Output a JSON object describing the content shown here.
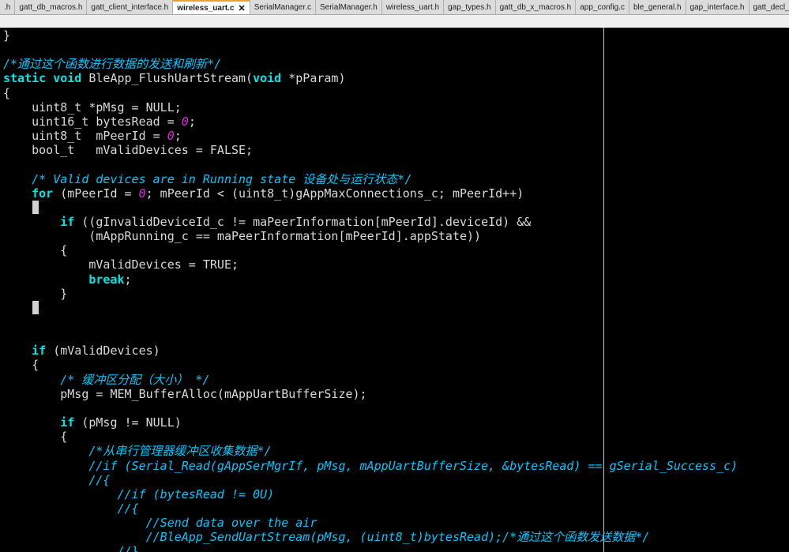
{
  "tabs": [
    {
      "label": ".h",
      "active": false
    },
    {
      "label": "gatt_db_macros.h",
      "active": false
    },
    {
      "label": "gatt_client_interface.h",
      "active": false
    },
    {
      "label": "wireless_uart.c",
      "active": true,
      "close": "✕"
    },
    {
      "label": "SerialManager.c",
      "active": false
    },
    {
      "label": "SerialManager.h",
      "active": false
    },
    {
      "label": "wireless_uart.h",
      "active": false
    },
    {
      "label": "gap_types.h",
      "active": false
    },
    {
      "label": "gatt_db_x_macros.h",
      "active": false
    },
    {
      "label": "app_config.c",
      "active": false
    },
    {
      "label": "ble_general.h",
      "active": false
    },
    {
      "label": "gap_interface.h",
      "active": false
    },
    {
      "label": "gatt_decl_x.h",
      "active": false
    }
  ],
  "code": [
    [
      [
        "p",
        "}"
      ]
    ],
    [],
    [
      [
        "c",
        "/*通过这个函数进行数据的发送和刷新*/"
      ]
    ],
    [
      [
        "k",
        "static"
      ],
      [
        "p",
        " "
      ],
      [
        "k",
        "void"
      ],
      [
        "p",
        " BleApp_FlushUartStream("
      ],
      [
        "k",
        "void"
      ],
      [
        "p",
        " *pParam)"
      ]
    ],
    [
      [
        "p",
        "{"
      ]
    ],
    [
      [
        "p",
        "    uint8_t *pMsg = NULL;"
      ]
    ],
    [
      [
        "p",
        "    uint16_t bytesRead = "
      ],
      [
        "n",
        "0"
      ],
      [
        "p",
        ";"
      ]
    ],
    [
      [
        "p",
        "    uint8_t  mPeerId = "
      ],
      [
        "n",
        "0"
      ],
      [
        "p",
        ";"
      ]
    ],
    [
      [
        "p",
        "    bool_t   mValidDevices = FALSE;"
      ]
    ],
    [],
    [
      [
        "p",
        "    "
      ],
      [
        "c",
        "/* Valid devices are in Running state 设备处与运行状态*/"
      ]
    ],
    [
      [
        "p",
        "    "
      ],
      [
        "k",
        "for"
      ],
      [
        "p",
        " (mPeerId = "
      ],
      [
        "n",
        "0"
      ],
      [
        "p",
        "; mPeerId < (uint8_t)gAppMaxConnections_c; mPeerId++)"
      ]
    ],
    [],
    [
      [
        "p",
        "        "
      ],
      [
        "k",
        "if"
      ],
      [
        "p",
        " ((gInvalidDeviceId_c != maPeerInformation[mPeerId].deviceId) &&"
      ]
    ],
    [
      [
        "p",
        "            (mAppRunning_c == maPeerInformation[mPeerId].appState))"
      ]
    ],
    [
      [
        "p",
        "        {"
      ]
    ],
    [
      [
        "p",
        "            mValidDevices = TRUE;"
      ]
    ],
    [
      [
        "p",
        "            "
      ],
      [
        "k",
        "break"
      ],
      [
        "p",
        ";"
      ]
    ],
    [
      [
        "p",
        "        }"
      ]
    ],
    [],
    [],
    [],
    [
      [
        "p",
        "    "
      ],
      [
        "k",
        "if"
      ],
      [
        "p",
        " (mValidDevices)"
      ]
    ],
    [
      [
        "p",
        "    {"
      ]
    ],
    [
      [
        "p",
        "        "
      ],
      [
        "c",
        "/* 缓冲区分配（大小） */"
      ]
    ],
    [
      [
        "p",
        "        pMsg = MEM_BufferAlloc(mAppUartBufferSize);"
      ]
    ],
    [],
    [
      [
        "p",
        "        "
      ],
      [
        "k",
        "if"
      ],
      [
        "p",
        " (pMsg != NULL)"
      ]
    ],
    [
      [
        "p",
        "        {"
      ]
    ],
    [
      [
        "p",
        "            "
      ],
      [
        "c",
        "/*从串行管理器缓冲区收集数据*/"
      ]
    ],
    [
      [
        "p",
        "            "
      ],
      [
        "c",
        "//if (Serial_Read(gAppSerMgrIf, pMsg, mAppUartBufferSize, &bytesRead) == gSerial_Success_c)"
      ]
    ],
    [
      [
        "p",
        "            "
      ],
      [
        "c",
        "//{"
      ]
    ],
    [
      [
        "p",
        "                "
      ],
      [
        "c",
        "//if (bytesRead != 0U)"
      ]
    ],
    [
      [
        "p",
        "                "
      ],
      [
        "c",
        "//{"
      ]
    ],
    [
      [
        "p",
        "                    "
      ],
      [
        "c",
        "//Send data over the air"
      ]
    ],
    [
      [
        "p",
        "                    "
      ],
      [
        "c",
        "//BleApp_SendUartStream(pMsg, (uint8_t)bytesRead);/*通过这个函数发送数据*/"
      ]
    ],
    [
      [
        "p",
        "                "
      ],
      [
        "c",
        "//}"
      ]
    ],
    [
      [
        "p",
        "            "
      ],
      [
        "c",
        "//}"
      ]
    ]
  ],
  "caret_rows": [
    12,
    19
  ]
}
